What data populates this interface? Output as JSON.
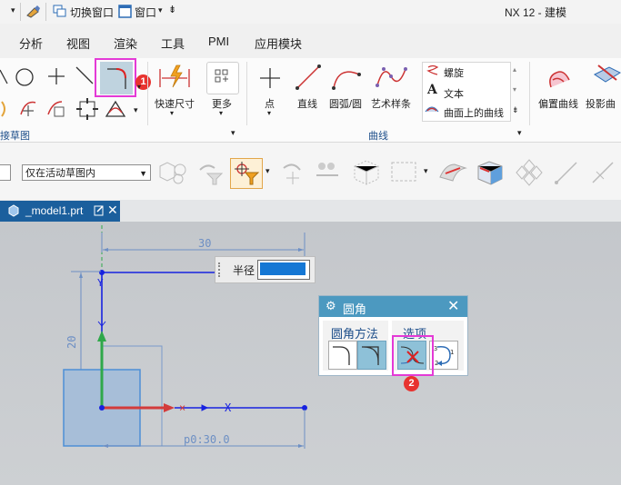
{
  "titlebar": {
    "switch_window": "切换窗口",
    "window_menu": "窗口",
    "app_title": "NX 12 - 建模"
  },
  "menu": [
    "分析",
    "视图",
    "渲染",
    "工具",
    "PMI",
    "应用模块"
  ],
  "ribbon": {
    "quick_dimension": "快速尺寸",
    "more": "更多",
    "point": "点",
    "line": "直线",
    "arc_circle": "圆弧/圆",
    "studio_spline": "艺术样条",
    "helix": "螺旋",
    "text": "文本",
    "curve_on_surface": "曲面上的曲线",
    "offset_curve": "偏置曲线",
    "projected_curve": "投影曲",
    "group_direct_sketch": "接草图",
    "group_curve": "曲线"
  },
  "selection": {
    "scope_value": "仅在活动草图内"
  },
  "tab": {
    "filename": "_model1.prt"
  },
  "sketch": {
    "dim_horizontal": "30",
    "dim_vertical": "20",
    "dim_p0": "p0:30.0",
    "axis_x": "X",
    "axis_y": "Y"
  },
  "radius_popup": {
    "label": "半径"
  },
  "fillet_dialog": {
    "title": "圆角",
    "method_label": "圆角方法",
    "options_label": "选项"
  },
  "callouts": [
    "1",
    "2"
  ],
  "colors": {
    "accent": "#1b5f9d",
    "highlight": "#e43ad6",
    "badge": "#e8332f",
    "dialog_header": "#4c99c0"
  }
}
